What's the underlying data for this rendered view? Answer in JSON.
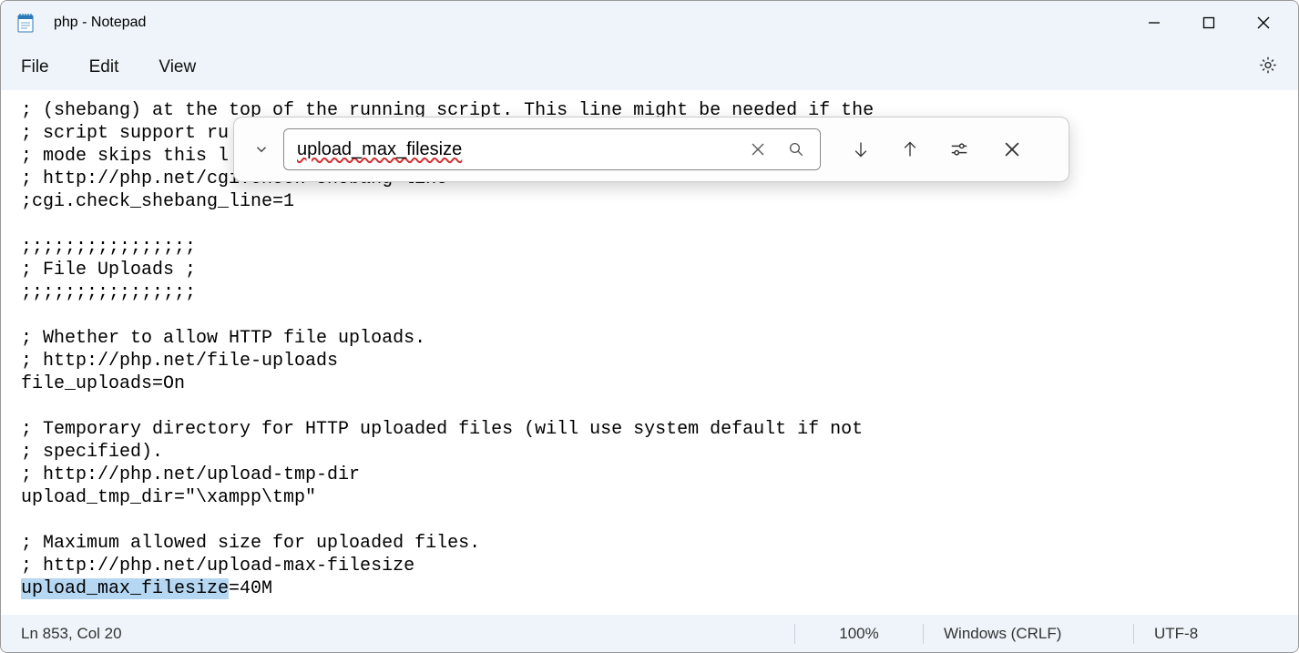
{
  "title": "php - Notepad",
  "menubar": {
    "file": "File",
    "edit": "Edit",
    "view": "View"
  },
  "find": {
    "value": "upload_max_filesize"
  },
  "editor": {
    "lines": [
      "; (shebang) at the top of the running script. This line might be needed if the",
      "; script support ru",
      "; mode skips this l",
      "; http://php.net/cgi.check-shebang-line",
      ";cgi.check_shebang_line=1",
      "",
      ";;;;;;;;;;;;;;;;",
      "; File Uploads ;",
      ";;;;;;;;;;;;;;;;",
      "",
      "; Whether to allow HTTP file uploads.",
      "; http://php.net/file-uploads",
      "file_uploads=On",
      "",
      "; Temporary directory for HTTP uploaded files (will use system default if not",
      "; specified).",
      "; http://php.net/upload-tmp-dir",
      "upload_tmp_dir=\"\\xampp\\tmp\"",
      "",
      "; Maximum allowed size for uploaded files.",
      "; http://php.net/upload-max-filesize"
    ],
    "match_prefix": "upload_max_filesize",
    "match_suffix": "=40M"
  },
  "statusbar": {
    "position": "Ln 853, Col 20",
    "zoom": "100%",
    "line_endings": "Windows (CRLF)",
    "encoding": "UTF-8"
  }
}
